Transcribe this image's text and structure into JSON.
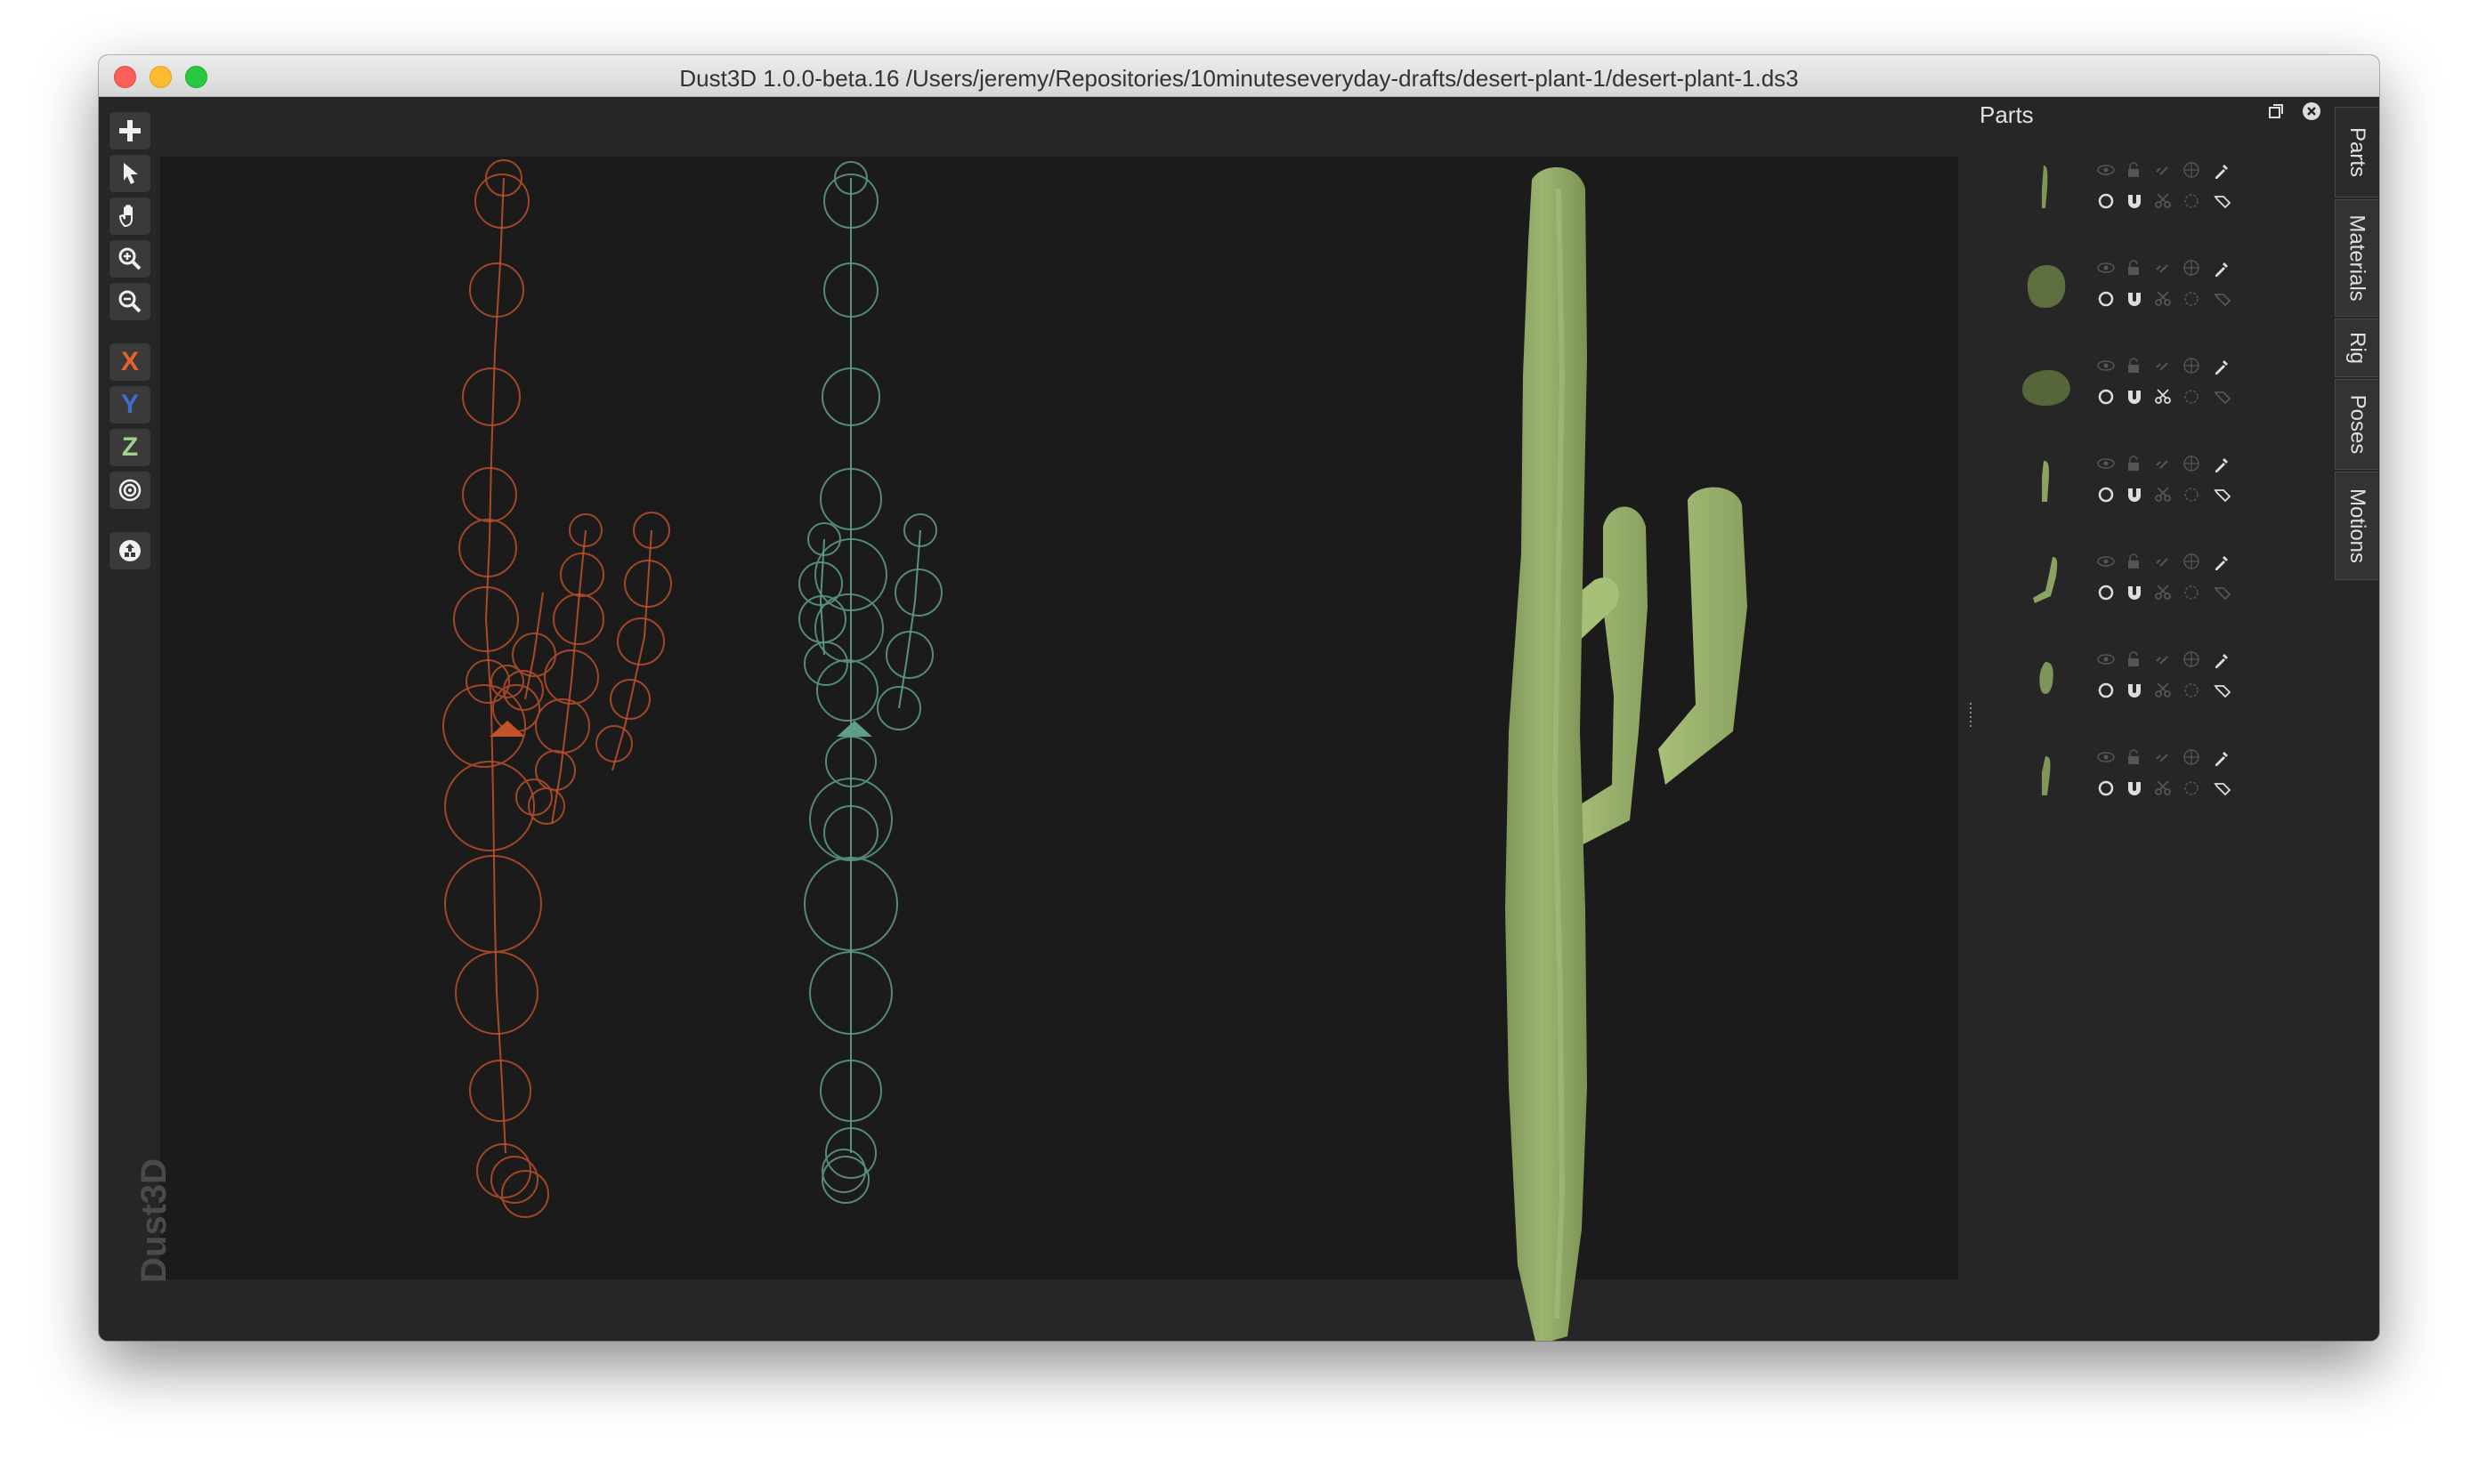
{
  "window": {
    "title": "Dust3D 1.0.0-beta.16 /Users/jeremy/Repositories/10minuteseveryday-drafts/desert-plant-1/desert-plant-1.ds3"
  },
  "toolbar": {
    "tools": [
      {
        "name": "add-icon"
      },
      {
        "name": "select-icon"
      },
      {
        "name": "pan-hand-icon"
      },
      {
        "name": "zoom-in-icon"
      },
      {
        "name": "zoom-out-icon"
      },
      {
        "name": "x-axis",
        "label": "X",
        "color": "#e8622b"
      },
      {
        "name": "y-axis",
        "label": "Y",
        "color": "#3f6ec9"
      },
      {
        "name": "z-axis",
        "label": "Z",
        "color": "#9ed28d"
      },
      {
        "name": "radial-icon"
      },
      {
        "name": "recycle-icon"
      }
    ]
  },
  "brand": {
    "watermark": "Dust3D"
  },
  "colors": {
    "side_view": "#c2522a",
    "front_view": "#5f9e88",
    "model": "#95ad6a",
    "panel_bg": "#262626",
    "viewport_bg": "#1b1b1b"
  },
  "parts_panel": {
    "title": "Parts",
    "restore_icon": "restore-icon",
    "close_icon": "close-icon",
    "parts": [
      {
        "thumb": "thin-stem"
      },
      {
        "thumb": "round-rock"
      },
      {
        "thumb": "flat-rock"
      },
      {
        "thumb": "short-arm"
      },
      {
        "thumb": "bent-arm"
      },
      {
        "thumb": "bud"
      },
      {
        "thumb": "small-arm"
      }
    ]
  },
  "side_tabs": [
    "Parts",
    "Materials",
    "Rig",
    "Poses",
    "Motions"
  ]
}
